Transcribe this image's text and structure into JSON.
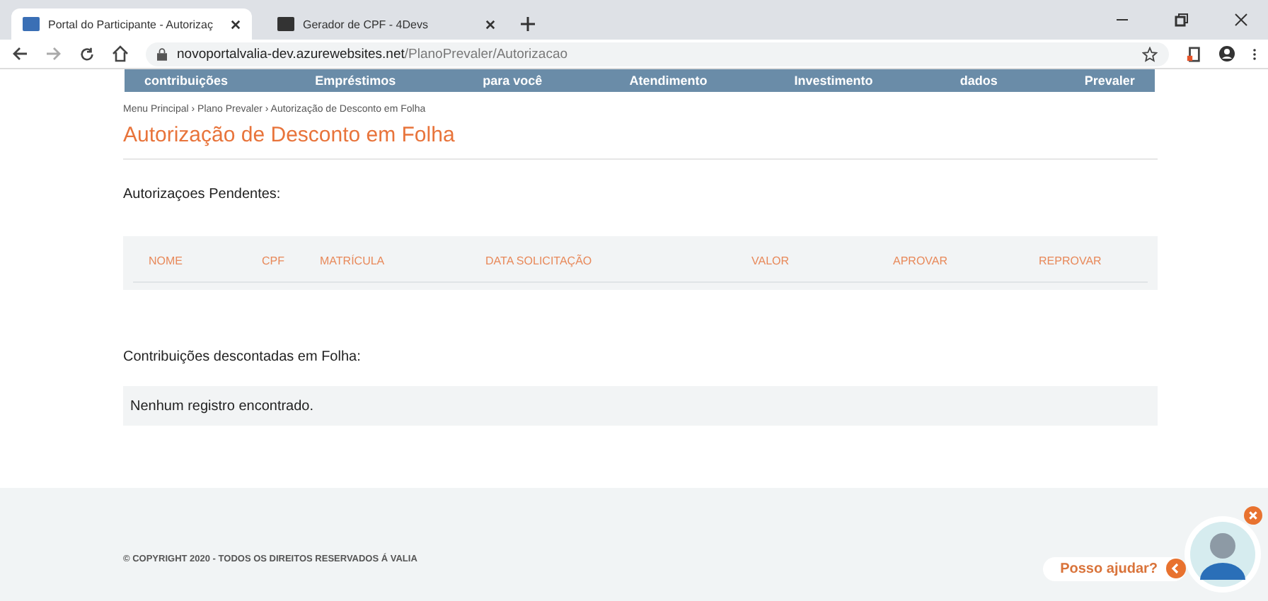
{
  "browser": {
    "tabs": [
      {
        "title": "Portal do Participante - Autorizaç",
        "selected": true
      },
      {
        "title": "Gerador de CPF - 4Devs",
        "selected": false
      }
    ],
    "url_host": "novoportalvalia-dev.azurewebsites.net",
    "url_path": "/PlanoPrevaler/Autorizacao"
  },
  "nav": [
    "contribuições",
    "Empréstimos",
    "para você",
    "Atendimento",
    "Investimento",
    "dados",
    "Prevaler"
  ],
  "breadcrumb": "Menu Principal › Plano Prevaler › Autorização de Desconto em Folha",
  "title": "Autorização de Desconto em Folha",
  "pending": {
    "label": "Autorizaçoes Pendentes:",
    "columns": [
      "NOME",
      "CPF",
      "MATRÍCULA",
      "DATA SOLICITAÇÃO",
      "VALOR",
      "APROVAR",
      "REPROVAR"
    ]
  },
  "discounted": {
    "label": "Contribuições descontadas em Folha:",
    "empty": "Nenhum registro encontrado."
  },
  "footer": "© COPYRIGHT 2020 - TODOS OS DIREITOS RESERVADOS Á VALIA",
  "help": {
    "label": "Posso ajudar?"
  }
}
